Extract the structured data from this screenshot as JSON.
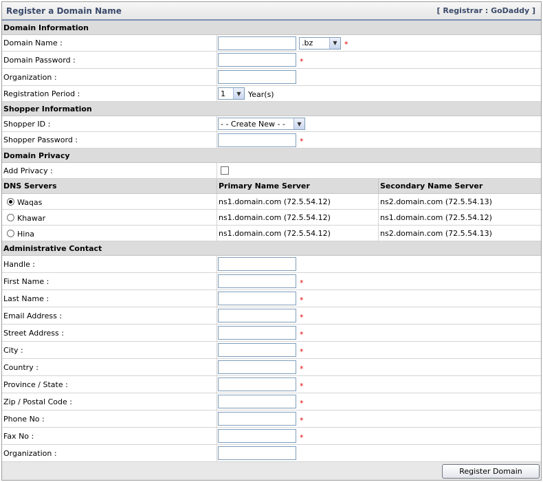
{
  "header": {
    "title": "Register a Domain Name",
    "registrar": "[ Registrar : GoDaddy ]"
  },
  "domain_info": {
    "section": "Domain Information",
    "domain_name_label": "Domain Name :",
    "domain_name_value": "",
    "tld_selected": ".bz",
    "domain_password_label": "Domain Password :",
    "organization_label": "Organization :",
    "registration_period_label": "Registration Period :",
    "period_selected": "1",
    "period_unit": "Year(s)"
  },
  "shopper_info": {
    "section": "Shopper Information",
    "shopper_id_label": "Shopper ID :",
    "shopper_id_selected": "- - Create New - -",
    "shopper_password_label": "Shopper Password :"
  },
  "privacy": {
    "section": "Domain Privacy",
    "add_privacy_label": "Add Privacy :",
    "add_privacy_checked": false
  },
  "dns": {
    "header": [
      "DNS Servers",
      "Primary Name Server",
      "Secondary Name Server"
    ],
    "rows": [
      {
        "name": "Waqas",
        "selected": true,
        "primary": "ns1.domain.com (72.5.54.12)",
        "secondary": "ns2.domain.com (72.5.54.13)"
      },
      {
        "name": "Khawar",
        "selected": false,
        "primary": "ns1.domain.com (72.5.54.12)",
        "secondary": "ns1.domain.com (72.5.54.12)"
      },
      {
        "name": "Hina",
        "selected": false,
        "primary": "ns1.domain.com (72.5.54.12)",
        "secondary": "ns2.domain.com (72.5.54.13)"
      }
    ]
  },
  "admin": {
    "section": "Administrative Contact",
    "fields": [
      {
        "label": "Handle :",
        "required": false
      },
      {
        "label": "First Name :",
        "required": true
      },
      {
        "label": "Last Name :",
        "required": true
      },
      {
        "label": "Email Address :",
        "required": true
      },
      {
        "label": "Street Address :",
        "required": true
      },
      {
        "label": "City :",
        "required": true
      },
      {
        "label": "Country :",
        "required": true
      },
      {
        "label": "Province / State :",
        "required": true
      },
      {
        "label": "Zip / Postal Code :",
        "required": true
      },
      {
        "label": "Phone No :",
        "required": true
      },
      {
        "label": "Fax No :",
        "required": true
      },
      {
        "label": "Organization :",
        "required": false
      }
    ]
  },
  "required_marker": "*",
  "submit_label": "Register Domain",
  "colors": {
    "required": "#e00000",
    "title": "#3a4a6a",
    "section_bg": "#dcdcdc"
  }
}
